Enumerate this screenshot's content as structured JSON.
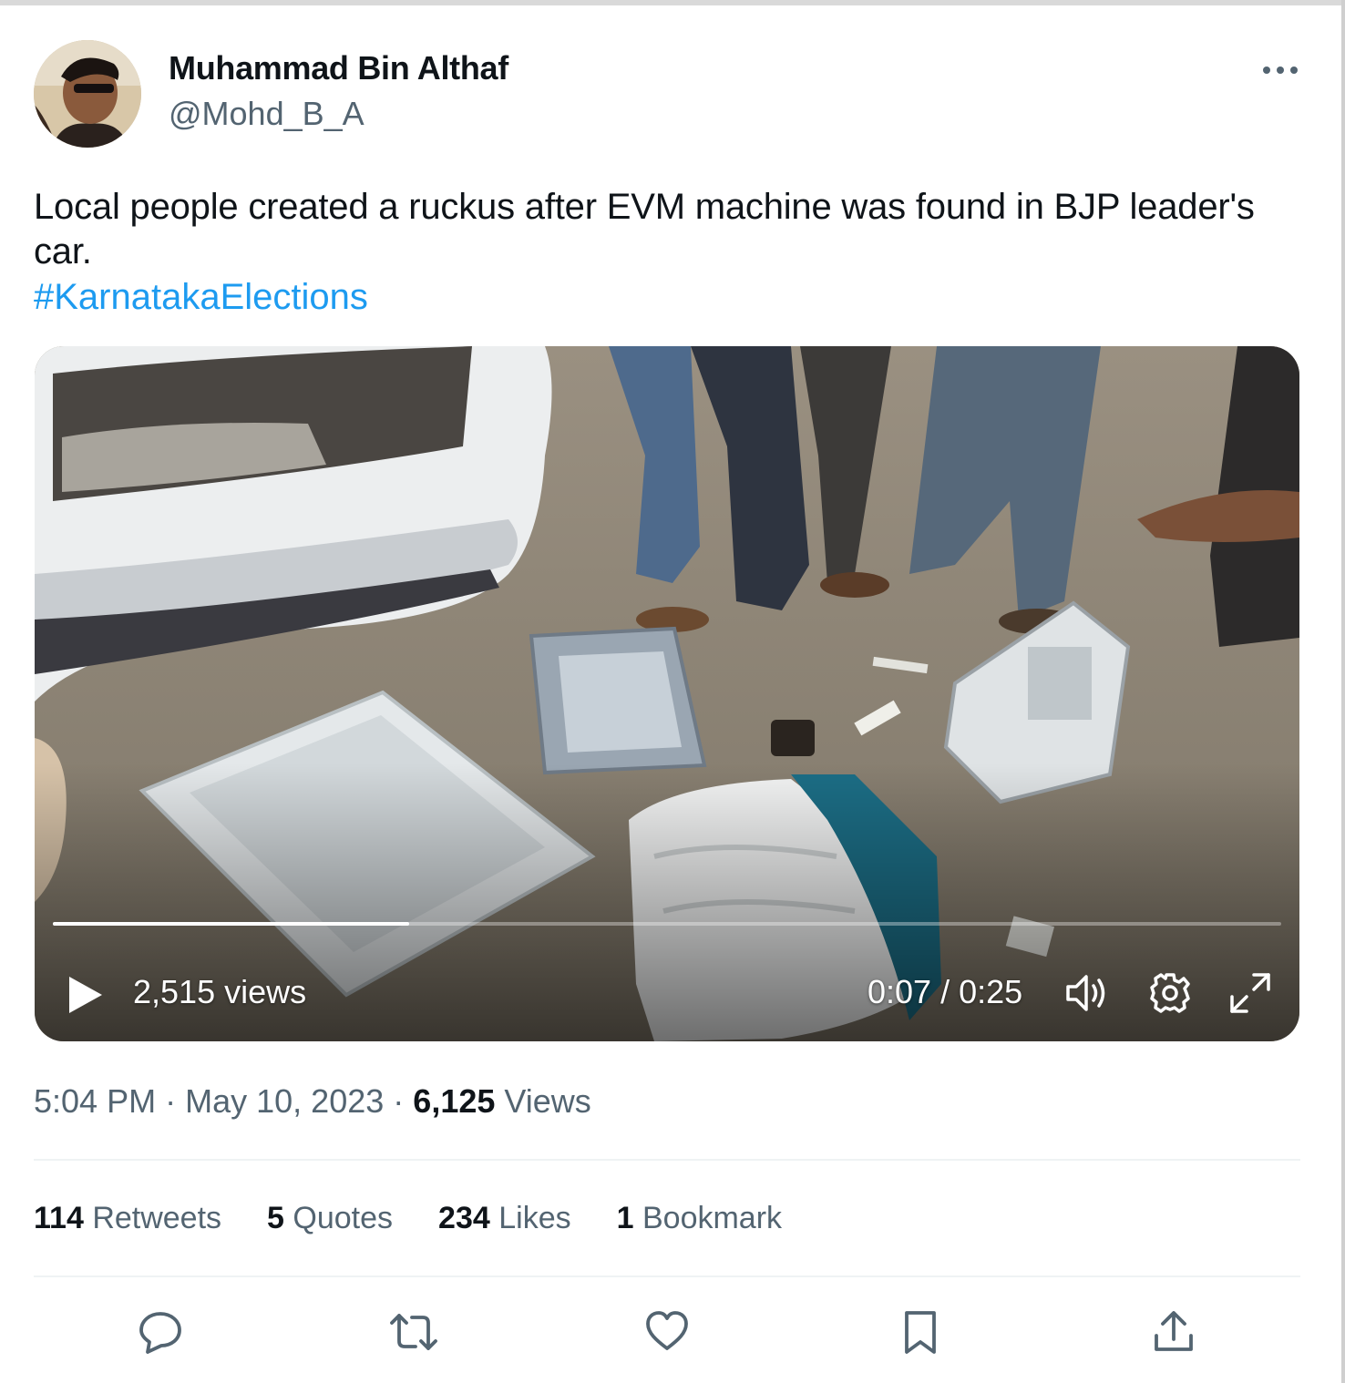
{
  "author": {
    "display_name": "Muhammad Bin Althaf",
    "handle": "@Mohd_B_A"
  },
  "tweet": {
    "text": "Local people created a ruckus after EVM machine was found in BJP leader's car.",
    "hashtag": "#KarnatakaElections"
  },
  "video": {
    "views": "2,515 views",
    "time": "0:07 / 0:25",
    "progress": 0.29
  },
  "meta": {
    "time": "5:04 PM",
    "separator": "·",
    "date": "May 10, 2023",
    "views_count": "6,125",
    "views_label": "Views"
  },
  "stats": {
    "retweets_count": "114",
    "retweets_label": "Retweets",
    "quotes_count": "5",
    "quotes_label": "Quotes",
    "likes_count": "234",
    "likes_label": "Likes",
    "bookmarks_count": "1",
    "bookmarks_label": "Bookmark"
  },
  "actions": [
    "reply-icon",
    "retweet-icon",
    "like-icon",
    "bookmark-icon",
    "share-icon"
  ],
  "colors": {
    "link": "#1d9bf0",
    "secondary_text": "#536471",
    "primary_text": "#0f1419"
  }
}
